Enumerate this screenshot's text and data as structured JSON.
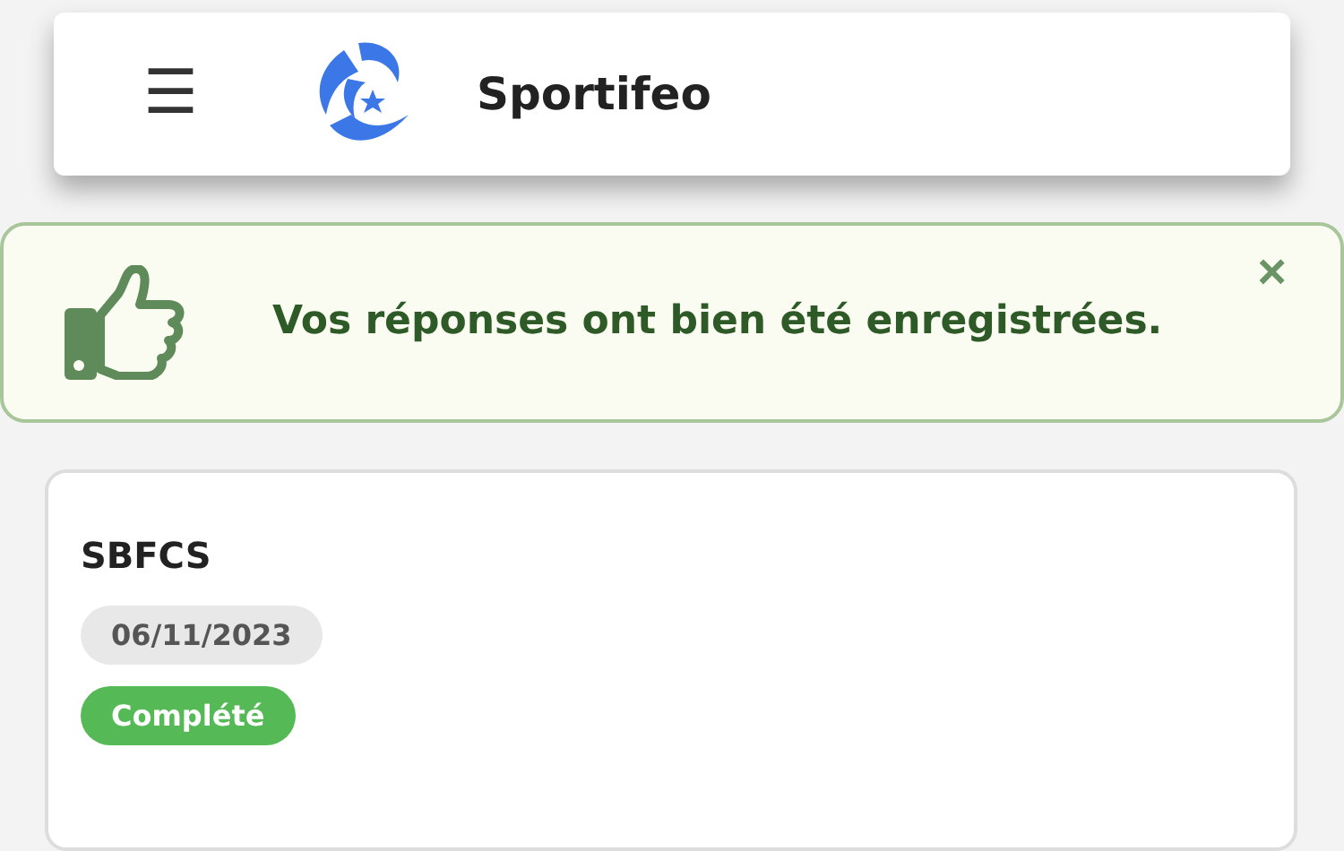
{
  "header": {
    "menu_icon": "☰",
    "brand": "Sportifeo"
  },
  "alert": {
    "message": "Vos réponses ont bien été enregistrées.",
    "close": "×"
  },
  "card": {
    "title": "SBFCS",
    "badges": [
      {
        "kind": "date",
        "text": "06/11/2023"
      },
      {
        "kind": "status",
        "text": "Complété"
      }
    ]
  }
}
